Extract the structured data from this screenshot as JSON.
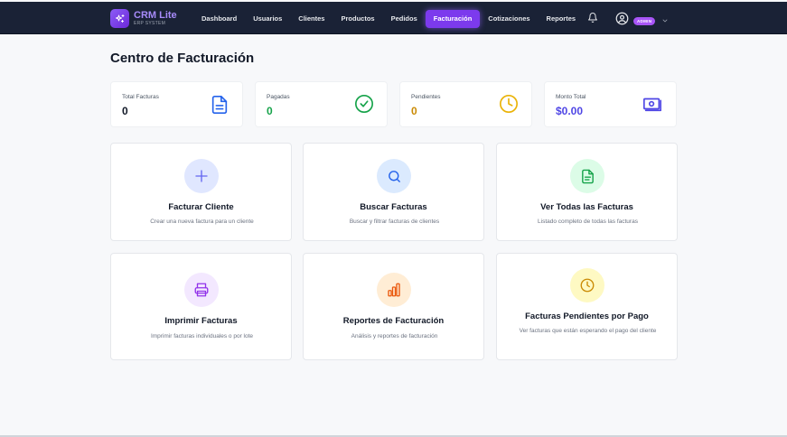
{
  "brand": {
    "name": "CRM Lite",
    "subtitle": "ERP SYSTEM",
    "logo_icon": "sparkles-icon"
  },
  "nav": {
    "items": [
      {
        "label": "Dashboard",
        "active": false
      },
      {
        "label": "Usuarios",
        "active": false
      },
      {
        "label": "Clientes",
        "active": false
      },
      {
        "label": "Productos",
        "active": false
      },
      {
        "label": "Pedidos",
        "active": false
      },
      {
        "label": "Facturación",
        "active": true
      },
      {
        "label": "Cotizaciones",
        "active": false
      },
      {
        "label": "Reportes",
        "active": false
      }
    ],
    "notification_icon": "bell-icon",
    "user": {
      "icon": "user-circle-icon",
      "role_badge": "ADMIN",
      "menu_icon": "chevron-down-icon"
    }
  },
  "page": {
    "title": "Centro de Facturación"
  },
  "stats": [
    {
      "label": "Total Facturas",
      "value": "0",
      "icon": "document-icon",
      "color": "#2563eb"
    },
    {
      "label": "Pagadas",
      "value": "0",
      "icon": "check-circle-icon",
      "color": "#16a34a"
    },
    {
      "label": "Pendientes",
      "value": "0",
      "icon": "clock-icon",
      "color": "#ca8a04"
    },
    {
      "label": "Monto Total",
      "value": "$0.00",
      "icon": "cash-icon",
      "color": "#4f46e5"
    }
  ],
  "actions": [
    {
      "title": "Facturar Cliente",
      "description": "Crear una nueva factura para un cliente",
      "icon": "plus-icon",
      "icon_color": "#6366f1",
      "bg": "#e0e7ff"
    },
    {
      "title": "Buscar Facturas",
      "description": "Buscar y filtrar facturas de clientes",
      "icon": "search-icon",
      "icon_color": "#2563eb",
      "bg": "#dbeafe"
    },
    {
      "title": "Ver Todas las Facturas",
      "description": "Listado completo de todas las facturas",
      "icon": "document-icon",
      "icon_color": "#16a34a",
      "bg": "#dcfce7"
    },
    {
      "title": "Imprimir Facturas",
      "description": "Imprimir facturas individuales o por lote",
      "icon": "printer-icon",
      "icon_color": "#9333ea",
      "bg": "#f3e8ff"
    },
    {
      "title": "Reportes de Facturación",
      "description": "Análisis y reportes de facturación",
      "icon": "bar-chart-icon",
      "icon_color": "#ea580c",
      "bg": "#ffedd5"
    },
    {
      "title": "Facturas Pendientes por Pago",
      "description": "Ver facturas que están esperando el pago del cliente",
      "icon": "clock-icon",
      "icon_color": "#ca8a04",
      "bg": "#fef9c3"
    }
  ]
}
